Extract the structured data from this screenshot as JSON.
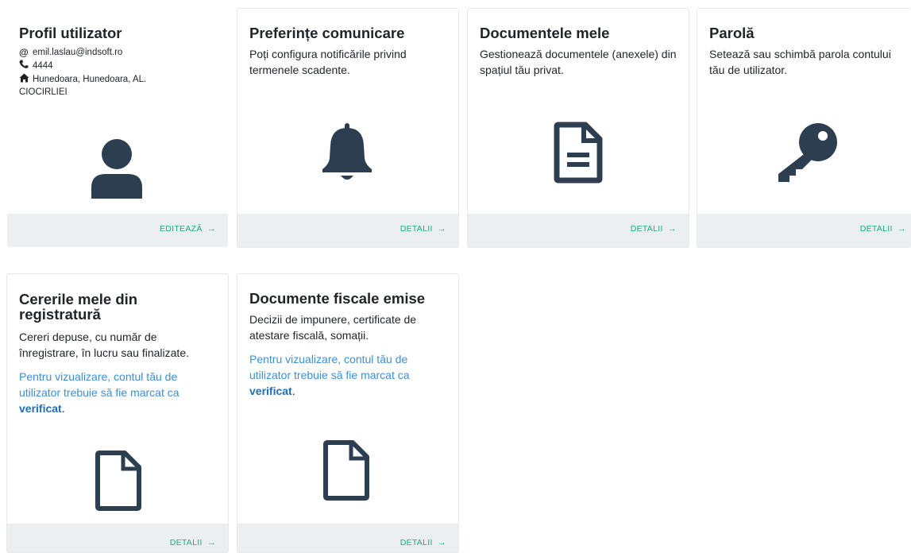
{
  "cards": [
    {
      "title": "Profil utilizator",
      "email": "emil.laslau@indsoft.ro",
      "phone": "4444",
      "address_line1": "Hunedoara, Hunedoara, AL.",
      "address_line2": "CIOCIRLIEI",
      "action": "EDITEAZĂ",
      "icon": "user-icon"
    },
    {
      "title": "Preferințe comunicare",
      "description": "Poți configura notificările privind termenele scadente.",
      "action": "DETALII",
      "icon": "bell-icon"
    },
    {
      "title": "Documentele mele",
      "description": "Gestionează documentele (anexele) din spațiul tău privat.",
      "action": "DETALII",
      "icon": "file-text-icon"
    },
    {
      "title": "Parolă",
      "description": "Setează sau schimbă parola contului tău de utilizator.",
      "action": "DETALII",
      "icon": "key-icon"
    },
    {
      "title": "Cererile mele din registratură",
      "description": "Cereri depuse, cu număr de înregistrare, în lucru sau finalizate.",
      "note": "Pentru vizualizare, contul tău de utilizator trebuie să fie marcat ca",
      "note_bold": "verificat",
      "note_end": ".",
      "action": "DETALII",
      "icon": "file-icon"
    },
    {
      "title": "Documente fiscale emise",
      "description": "Decizii de impunere, certificate de atestare fiscală, somații.",
      "note": "Pentru vizualizare, contul tău de utilizator trebuie să fie marcat ca",
      "note_bold": "verificat",
      "note_end": ".",
      "action": "DETALII",
      "icon": "file-icon"
    }
  ],
  "colors": {
    "icon": "#2d3e50",
    "link": "#1eaa80",
    "note": "#3a8fd8",
    "footer": "#ecefef"
  }
}
